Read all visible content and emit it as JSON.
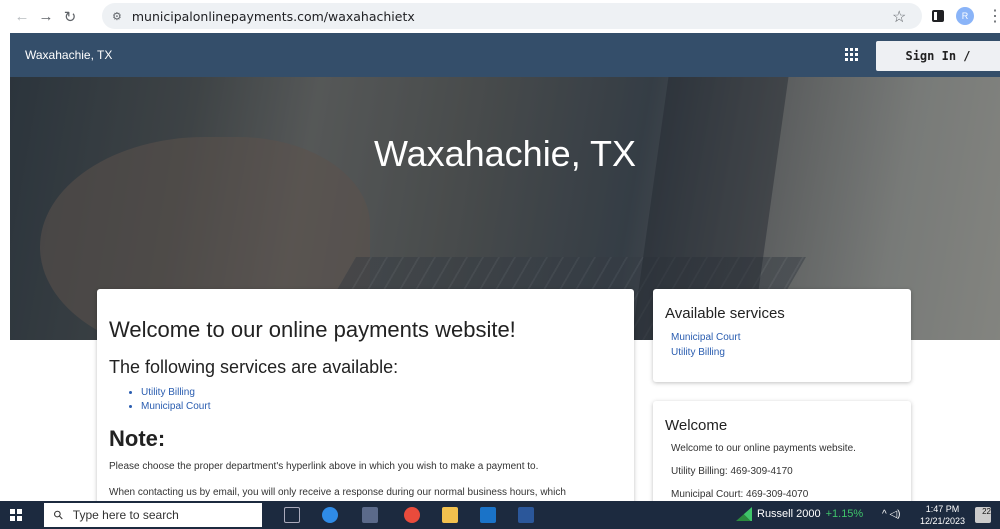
{
  "browser": {
    "url": "municipalonlinepayments.com/waxahachietx",
    "profile_initial": "R"
  },
  "header": {
    "site_title": "Waxahachie, TX",
    "signin_label": "Sign In / Register"
  },
  "hero": {
    "title": "Waxahachie, TX"
  },
  "main": {
    "heading": "Welcome to our online payments website!",
    "services_heading": "The following services are available:",
    "services": [
      "Utility Billing",
      "Municipal Court"
    ],
    "note_heading": "Note:",
    "note_text": "Please choose the proper department's hyperlink above in which you wish to make a payment to.",
    "note_text_2": "When contacting us by email, you will only receive a response during our normal business hours, which"
  },
  "sidebar": {
    "services_title": "Available services",
    "services": [
      "Municipal Court",
      "Utility Billing"
    ],
    "welcome_title": "Welcome",
    "welcome_lines": [
      "Welcome to our online payments website.",
      "Utility Billing: 469-309-4170",
      "Municipal Court: 469-309-4070"
    ]
  },
  "taskbar": {
    "search_placeholder": "Type here to search",
    "stock_name": "Russell 2000",
    "stock_change": "+1.15%",
    "time": "1:47 PM",
    "date": "12/21/2023",
    "notification_count": "22"
  }
}
